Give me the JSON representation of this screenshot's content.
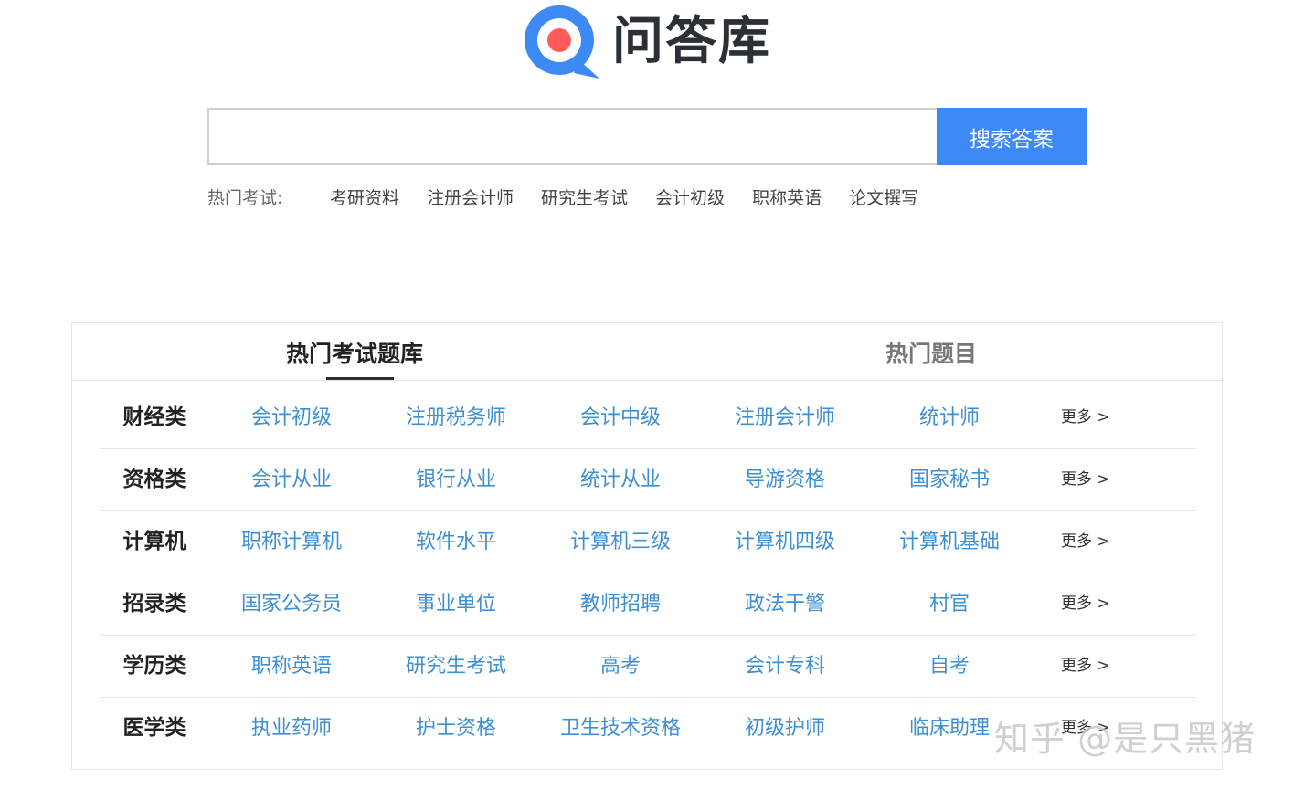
{
  "logo": {
    "text": "问答库",
    "mark_color": "#3d8af7",
    "dot_color": "#ff5b5b"
  },
  "search": {
    "value": "",
    "placeholder": "",
    "button_label": "搜索答案",
    "button_color": "#3d8af7"
  },
  "hot_exams": {
    "label": "热门考试:",
    "links": [
      "考研资料",
      "注册会计师",
      "研究生考试",
      "会计初级",
      "职称英语",
      "论文撰写"
    ]
  },
  "tabs": [
    {
      "label": "热门考试题库",
      "active": true
    },
    {
      "label": "热门题目",
      "active": false
    }
  ],
  "categories": [
    {
      "title": "财经类",
      "items": [
        "会计初级",
        "注册税务师",
        "会计中级",
        "注册会计师",
        "统计师"
      ],
      "more": "更多 >"
    },
    {
      "title": "资格类",
      "items": [
        "会计从业",
        "银行从业",
        "统计从业",
        "导游资格",
        "国家秘书"
      ],
      "more": "更多 >"
    },
    {
      "title": "计算机",
      "items": [
        "职称计算机",
        "软件水平",
        "计算机三级",
        "计算机四级",
        "计算机基础"
      ],
      "more": "更多 >"
    },
    {
      "title": "招录类",
      "items": [
        "国家公务员",
        "事业单位",
        "教师招聘",
        "政法干警",
        "村官"
      ],
      "more": "更多 >"
    },
    {
      "title": "学历类",
      "items": [
        "职称英语",
        "研究生考试",
        "高考",
        "会计专科",
        "自考"
      ],
      "more": "更多 >"
    },
    {
      "title": "医学类",
      "items": [
        "执业药师",
        "护士资格",
        "卫生技术资格",
        "初级护师",
        "临床助理"
      ],
      "more": "更多 >"
    }
  ],
  "watermark": "知乎 @是只黑猪",
  "link_color": "#3f8fd4"
}
